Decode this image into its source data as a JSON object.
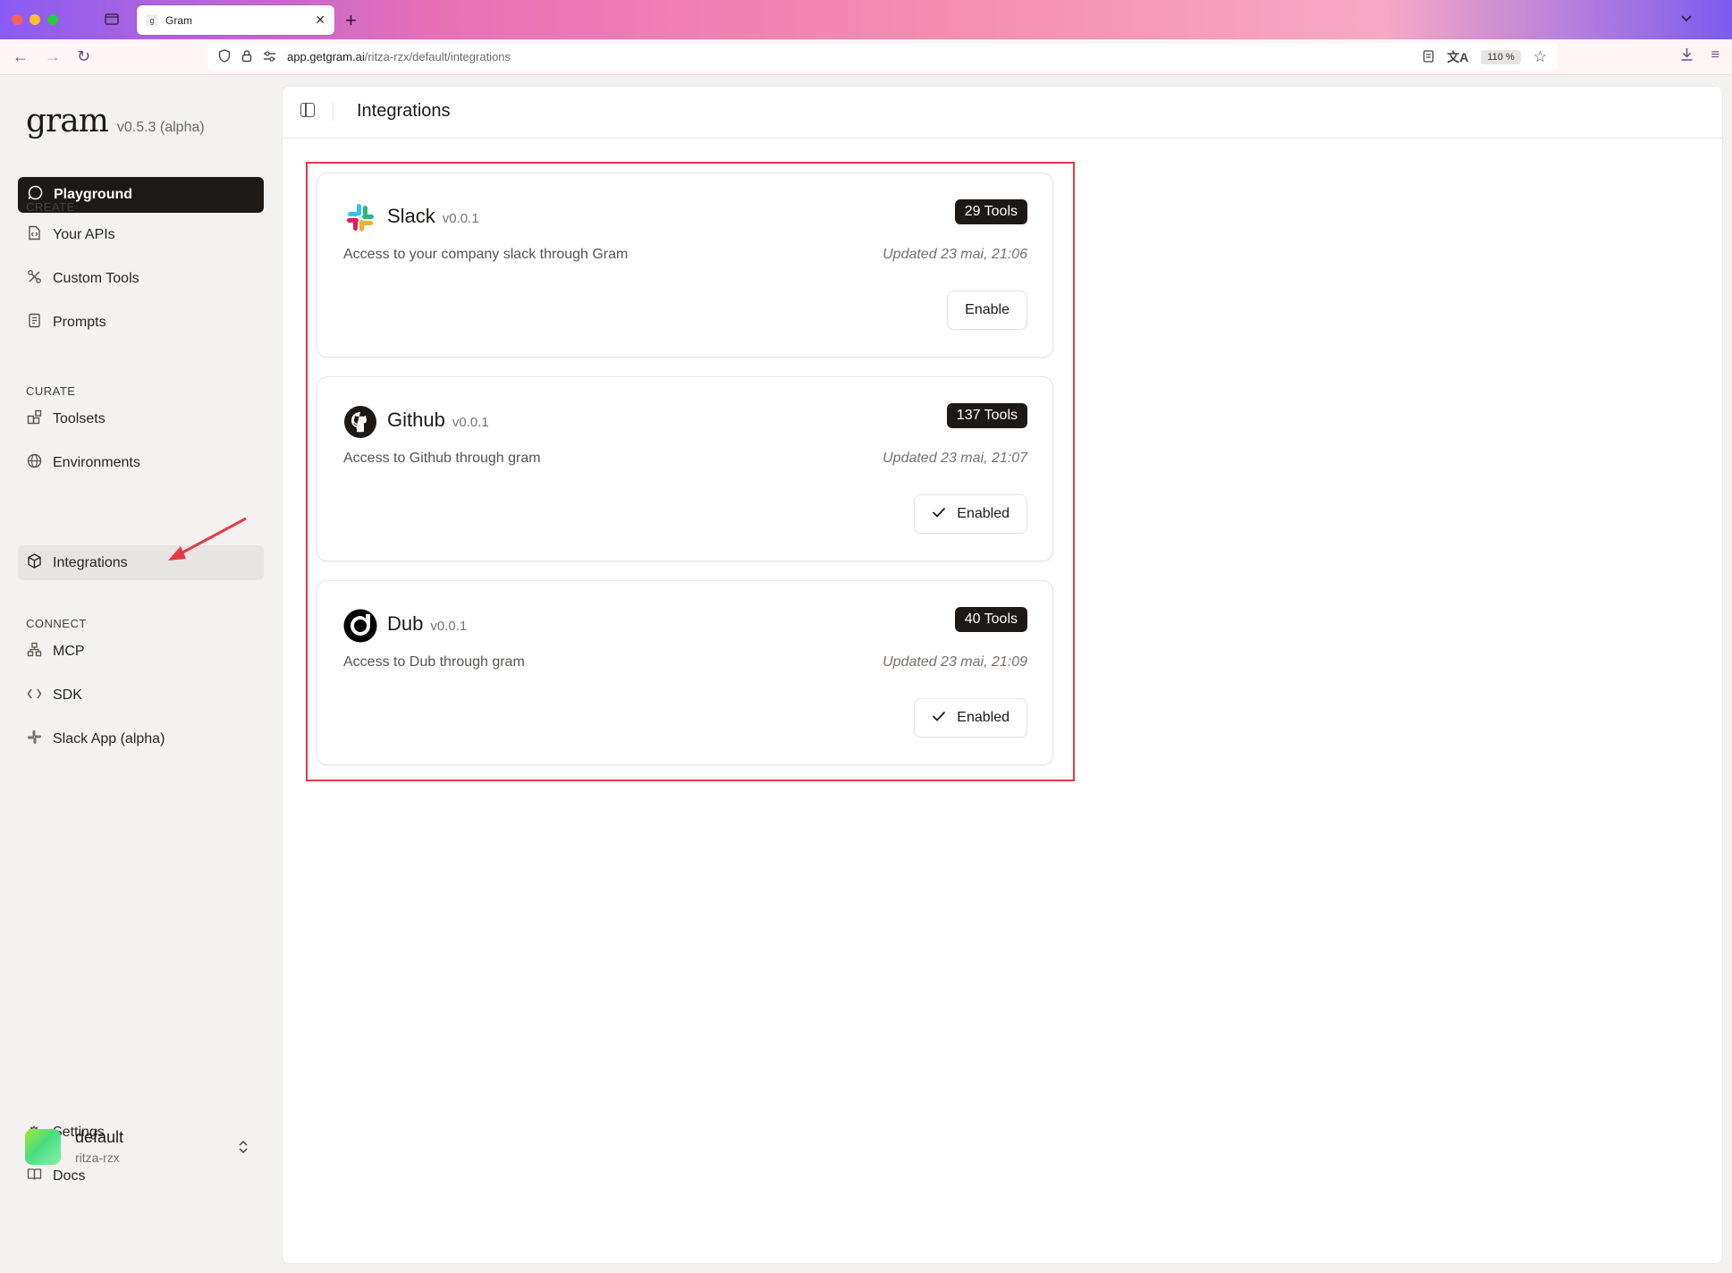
{
  "browser": {
    "tab_title": "Gram",
    "tab_favicon": "g",
    "url_domain": "app.getgram.ai",
    "url_path": "/ritza-rzx/default/integrations",
    "zoom": "110 %"
  },
  "sidebar": {
    "logo": "gram",
    "version": "v0.5.3 (alpha)",
    "playground_label": "Playground",
    "sections": {
      "create": "CREATE",
      "curate": "CURATE",
      "connect": "CONNECT"
    },
    "items": {
      "your_apis": "Your APIs",
      "custom_tools": "Custom Tools",
      "prompts": "Prompts",
      "toolsets": "Toolsets",
      "environments": "Environments",
      "integrations": "Integrations",
      "mcp": "MCP",
      "sdk": "SDK",
      "slack_app": "Slack App (alpha)",
      "settings": "Settings",
      "docs": "Docs"
    },
    "user": {
      "name": "default",
      "sub": "ritza-rzx"
    }
  },
  "main": {
    "title": "Integrations",
    "cards": [
      {
        "name": "Slack",
        "version": "v0.0.1",
        "tools": "29 Tools",
        "description": "Access to your company slack through Gram",
        "updated": "Updated 23 mai, 21:06",
        "button": "Enable",
        "enabled": false
      },
      {
        "name": "Github",
        "version": "v0.0.1",
        "tools": "137 Tools",
        "description": "Access to Github through gram",
        "updated": "Updated 23 mai, 21:07",
        "button": "Enabled",
        "enabled": true
      },
      {
        "name": "Dub",
        "version": "v0.0.1",
        "tools": "40 Tools",
        "description": "Access to Dub through gram",
        "updated": "Updated 23 mai, 21:09",
        "button": "Enabled",
        "enabled": true
      }
    ]
  },
  "colors": {
    "accent_dark": "#1c1917",
    "highlight_red": "#e53945"
  }
}
